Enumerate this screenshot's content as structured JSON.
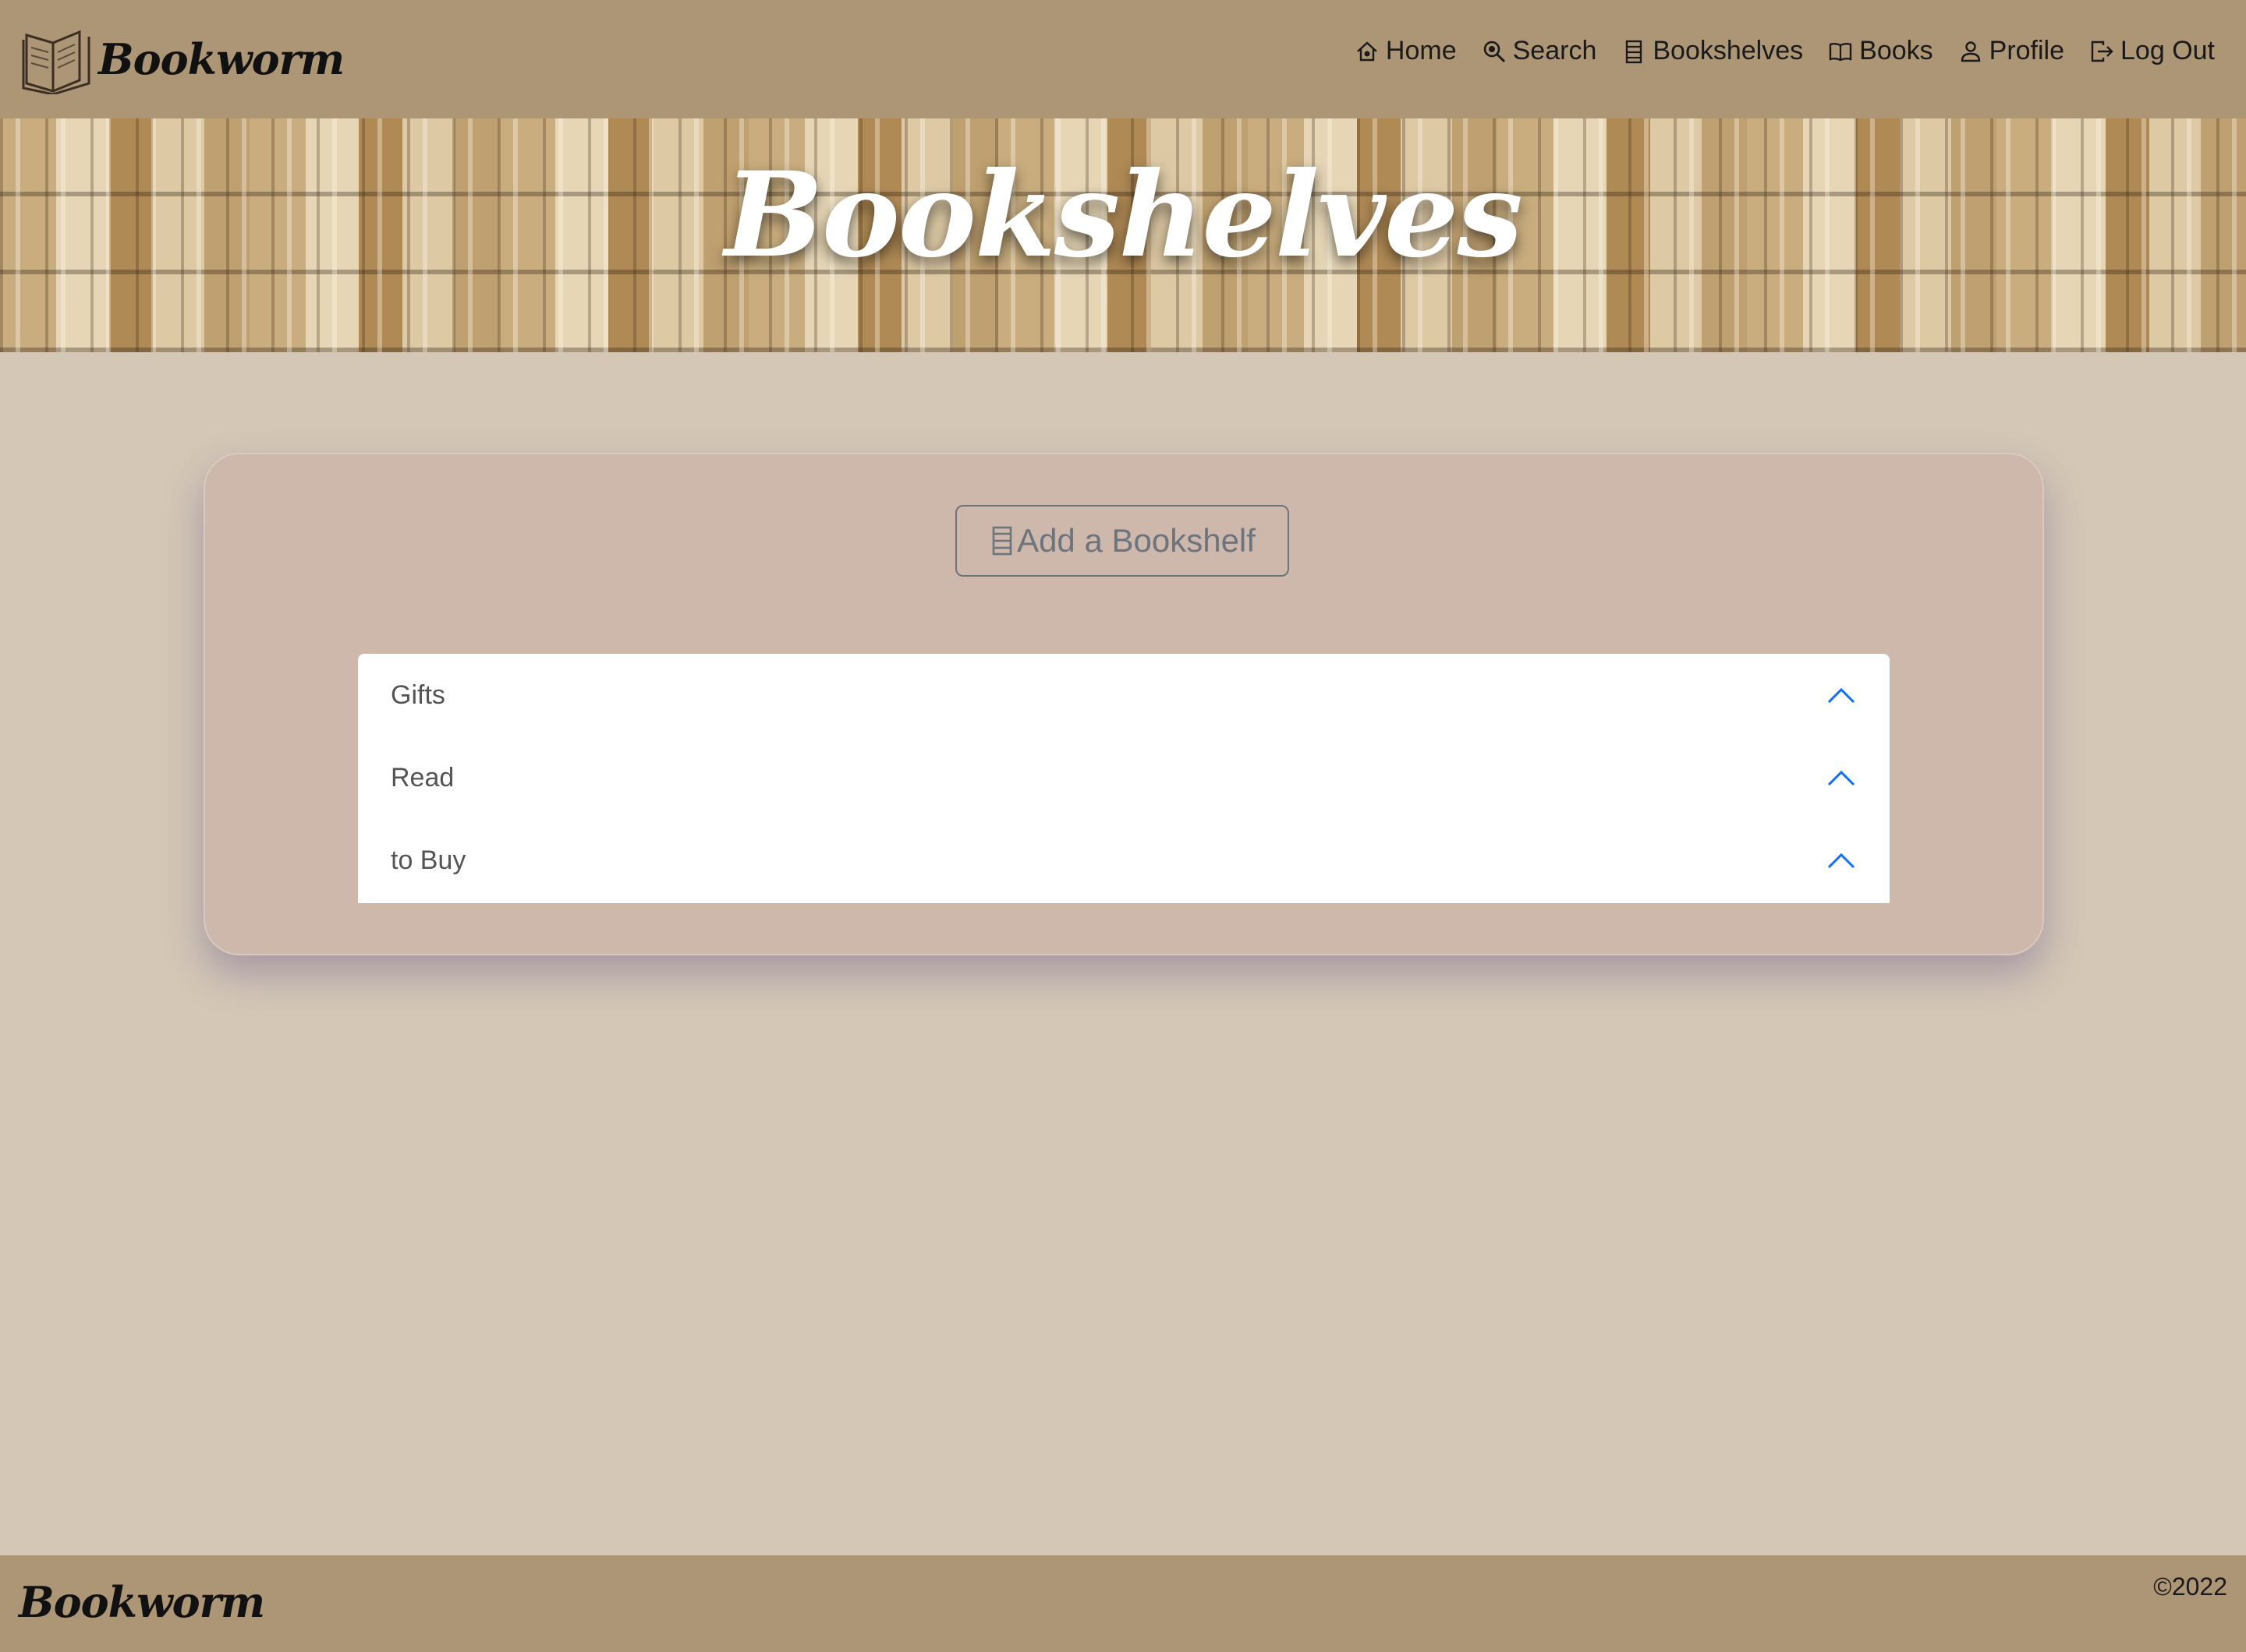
{
  "brand": {
    "name": "Bookworm"
  },
  "nav": {
    "items": [
      {
        "label": "Home",
        "icon": "house-icon"
      },
      {
        "label": "Search",
        "icon": "search-icon"
      },
      {
        "label": "Bookshelves",
        "icon": "bookshelf-icon"
      },
      {
        "label": "Books",
        "icon": "book-icon"
      },
      {
        "label": "Profile",
        "icon": "person-icon"
      },
      {
        "label": "Log Out",
        "icon": "logout-icon"
      }
    ]
  },
  "hero": {
    "title": "Bookshelves"
  },
  "main": {
    "add_button_label": "Add a Bookshelf",
    "add_button_icon": "bookshelf-icon",
    "shelves": [
      {
        "label": "Gifts",
        "icon": "chevron-up-icon"
      },
      {
        "label": "Read",
        "icon": "chevron-up-icon"
      },
      {
        "label": "to Buy",
        "icon": "chevron-up-icon"
      }
    ]
  },
  "footer": {
    "brand": "Bookworm",
    "copyright": "©2022"
  },
  "colors": {
    "navbar": "#ad9675",
    "background": "#d4c7b6",
    "card": "#ceb7ab",
    "accordion_chevron": "#0d6efd",
    "button_outline": "#6c757d"
  }
}
